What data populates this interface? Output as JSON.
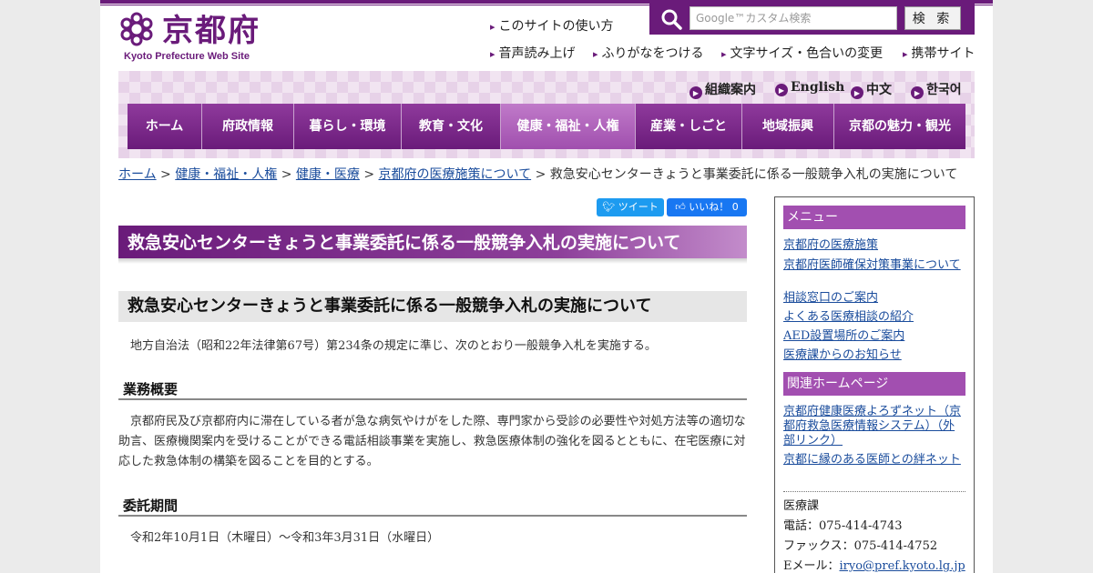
{
  "header": {
    "logo_text": "京都府",
    "logo_subtitle": "Kyoto Prefecture Web Site",
    "util_links": [
      "このサイトの使い方",
      "音声読み上げ",
      "ふりがなをつける",
      "文字サイズ・色合いの変更",
      "携帯サイト"
    ],
    "search_placeholder": "Google™カスタム検索",
    "search_button": "検 索"
  },
  "languages": [
    "組織案内",
    "English",
    "中文",
    "한국어"
  ],
  "global_nav": [
    "ホーム",
    "府政情報",
    "暮らし・環境",
    "教育・文化",
    "健康・福祉・人権",
    "産業・しごと",
    "地域振興",
    "京都の魅力・観光"
  ],
  "global_nav_active": "健康・福祉・人権",
  "breadcrumb": {
    "links": [
      "ホーム",
      "健康・福祉・人権",
      "健康・医療",
      "京都府の医療施策について"
    ],
    "separator": ">",
    "current": "救急安心センターきょうと事業委託に係る一般競争入札の実施について"
  },
  "social": {
    "tweet": "ツイート",
    "like": "いいね！ 0"
  },
  "main": {
    "title": "救急安心センターきょうと事業委託に係る一般競争入札の実施について",
    "subtitle": "救急安心センターきょうと事業委託に係る一般競争入札の実施について",
    "intro": "　地方自治法（昭和22年法律第67号）第234条の規定に準じ、次のとおり一般競争入札を実施する。",
    "sections": [
      {
        "heading": "業務概要",
        "body": "　京都府民及び京都府内に滞在している者が急な病気やけがをした際、専門家から受診の必要性や対処方法等の適切な助言、医療機関案内を受けることができる電話相談事業を実施し、救急医療体制の強化を図るとともに、在宅医療に対応した救急体制の構築を図ることを目的とする。"
      },
      {
        "heading": "委託期間",
        "body": "　令和2年10月1日（木曜日）～令和3年3月31日（水曜日）"
      }
    ]
  },
  "sidebar": {
    "menu_heading": "メニュー",
    "menu_links": [
      "京都府の医療施策",
      "京都府医師確保対策事業について",
      "相談窓口のご案内",
      "よくある医療相談の紹介",
      "AED設置場所のご案内",
      "医療課からのお知らせ"
    ],
    "related_heading": "関連ホームページ",
    "related_links": [
      "京都府健康医療よろずネット（京都府救急医療情報システム）（外部リンク）",
      "京都に縁のある医師との絆ネット"
    ],
    "contact": {
      "department": "医療課",
      "phone_label": "電話：",
      "phone": "075-414-4743",
      "fax_label": "ファックス：",
      "fax": "075-414-4752",
      "email_label": "Eメール：",
      "email": "iryo@pref.kyoto.lg.jp"
    }
  },
  "colors": {
    "brand": "#6a1b7a",
    "nav_active": "#a04fae",
    "link": "#1a4c9c"
  }
}
